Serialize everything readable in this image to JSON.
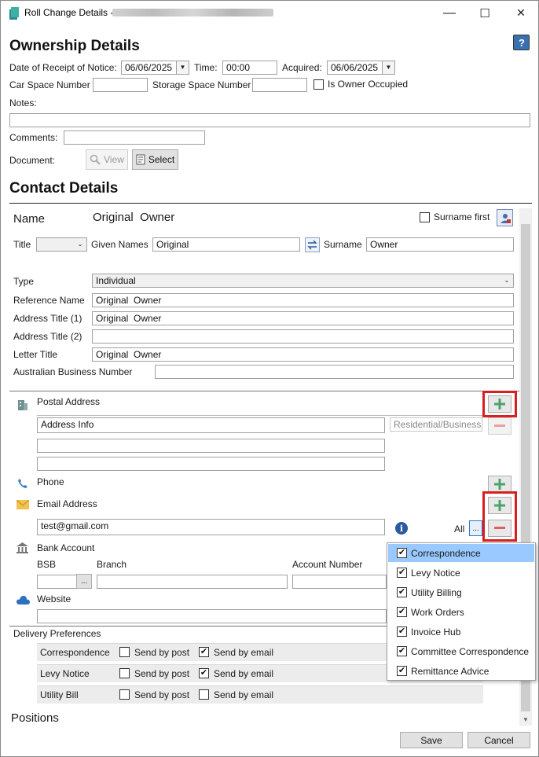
{
  "window": {
    "title": "Roll Change Details - ",
    "minimize": "—",
    "maximize": "☐",
    "close": "✕"
  },
  "ownership": {
    "heading": "Ownership Details",
    "date_label": "Date of Receipt of Notice:",
    "date_value": "06/06/2025",
    "time_label": "Time:",
    "time_value": "00:00",
    "acquired_label": "Acquired:",
    "acquired_value": "06/06/2025",
    "car_space_label": "Car Space Number",
    "car_space_value": "",
    "storage_label": "Storage Space Number",
    "storage_value": "",
    "owner_occupied_label": "Is Owner Occupied",
    "notes_label": "Notes:",
    "notes_value": "",
    "comments_label": "Comments:",
    "comments_value": "",
    "document_label": "Document:",
    "view_button": "View",
    "select_button": "Select"
  },
  "contact": {
    "heading": "Contact Details",
    "name_label": "Name",
    "name_value": "Original  Owner",
    "surname_first_label": "Surname first",
    "title_label": "Title",
    "title_value": "",
    "given_names_label": "Given Names",
    "given_names_value": "Original",
    "surname_label": "Surname",
    "surname_value": "Owner",
    "type_label": "Type",
    "type_value": "Individual",
    "reference_name_label": "Reference Name",
    "reference_name_value": "Original  Owner",
    "address_title1_label": "Address Title (1)",
    "address_title1_value": "Original  Owner",
    "address_title2_label": "Address Title (2)",
    "address_title2_value": "",
    "letter_title_label": "Letter Title",
    "letter_title_value": "Original  Owner",
    "abn_label": "Australian Business Number",
    "abn_value": ""
  },
  "postal": {
    "label": "Postal Address",
    "line1": "Address Info",
    "line2": "",
    "line3": "",
    "type_value": "Residential/Business"
  },
  "phone": {
    "label": "Phone"
  },
  "email": {
    "label": "Email Address",
    "value": "test@gmail.com",
    "all_label": "All",
    "more_button": "..."
  },
  "bank": {
    "label": "Bank Account",
    "bsb_label": "BSB",
    "branch_label": "Branch",
    "account_number_label": "Account Number",
    "bsb_button": "...",
    "bsb_value": "",
    "branch_value": "",
    "account_value": ""
  },
  "website": {
    "label": "Website",
    "value": ""
  },
  "delivery": {
    "heading": "Delivery Preferences",
    "rows": [
      {
        "name": "Correspondence",
        "post_label": "Send by post",
        "post": false,
        "email_label": "Send by email",
        "email": true
      },
      {
        "name": "Levy Notice",
        "post_label": "Send by post",
        "post": false,
        "email_label": "Send by email",
        "email": true
      },
      {
        "name": "Utility Bill",
        "post_label": "Send by post",
        "post": false,
        "email_label": "Send by email",
        "email": false
      }
    ]
  },
  "positions_label": "Positions",
  "popup_items": [
    {
      "label": "Correspondence",
      "checked": true,
      "selected": true
    },
    {
      "label": "Levy Notice",
      "checked": true,
      "selected": false
    },
    {
      "label": "Utility Billing",
      "checked": true,
      "selected": false
    },
    {
      "label": "Work Orders",
      "checked": true,
      "selected": false
    },
    {
      "label": "Invoice Hub",
      "checked": true,
      "selected": false
    },
    {
      "label": "Committee Correspondence",
      "checked": true,
      "selected": false
    },
    {
      "label": "Remittance Advice",
      "checked": true,
      "selected": false
    }
  ],
  "footer": {
    "save": "Save",
    "cancel": "Cancel"
  },
  "colors": {
    "highlight": "#d81e1e",
    "selection": "#99c9ff",
    "plus": "#4aa36b",
    "minus": "#e06060"
  },
  "icons": [
    "app-icon",
    "help-icon",
    "search-icon",
    "document-icon",
    "swap-icon",
    "contact-card-icon",
    "building-icon",
    "phone-icon",
    "envelope-icon",
    "info-icon",
    "bank-icon",
    "cloud-icon"
  ]
}
